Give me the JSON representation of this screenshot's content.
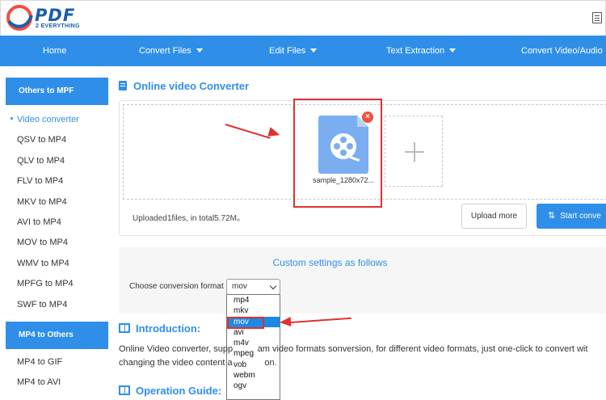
{
  "brand": {
    "name": "PDF",
    "tagline": "2 EVERYTHING",
    "accent_color": "#2f8fe8"
  },
  "nav": {
    "items": [
      {
        "label": "Home",
        "dropdown": false
      },
      {
        "label": "Convert Files",
        "dropdown": true
      },
      {
        "label": "Edit Files",
        "dropdown": true
      },
      {
        "label": "Text Extraction",
        "dropdown": true
      },
      {
        "label": "Convert Video/Audio",
        "dropdown": true
      }
    ]
  },
  "sidebar": {
    "section1_title": "Others to MPF",
    "section1_items": [
      "Video converter",
      "QSV to MP4",
      "QLV to MP4",
      "FLV to MP4",
      "MKV to MP4",
      "AVI to MP4",
      "MOV to MP4",
      "WMV to MP4",
      "MPFG to MP4",
      "SWF to MP4"
    ],
    "active_item": "Video converter",
    "section2_title": "MP4 to Others",
    "section2_items": [
      "MP4 to GIF",
      "MP4 to AVI"
    ]
  },
  "converter": {
    "title": "Online video Converter",
    "file_name": "sample_1280x72...",
    "remove_label": "×",
    "add_label": "+",
    "upload_info": "Uploaded1files, in total5.72M。",
    "upload_more_label": "Upload more",
    "start_label": "Start conve"
  },
  "settings": {
    "title": "Custom settings as follows",
    "choose_label": "Choose conversion format",
    "selected_format": "mov",
    "formats": [
      "mp4",
      "mkv",
      "mov",
      "avi",
      "m4v",
      "mpeg",
      "vob",
      "webm",
      "ogv"
    ]
  },
  "introduction": {
    "title": "Introduction:",
    "line1": "Online Video converter, supp          am video formats sonversion, for different video formats, just one-click to convert wit",
    "line2": "changing the video content a             on."
  },
  "operation": {
    "title": "Operation Guide:"
  }
}
